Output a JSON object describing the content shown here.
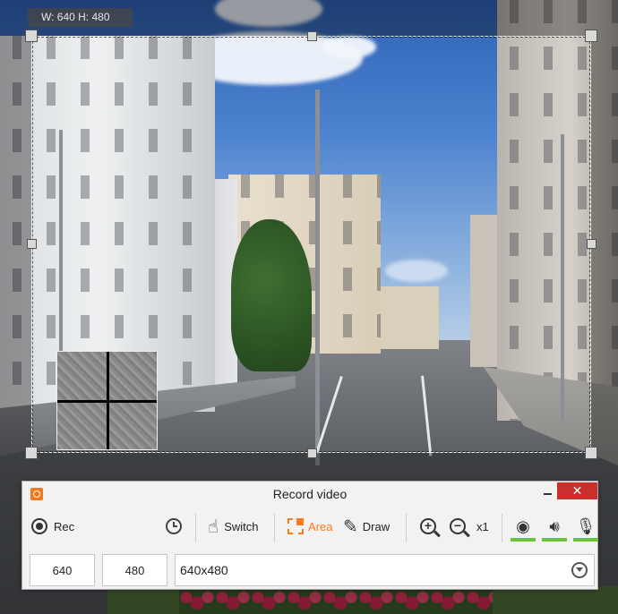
{
  "capture": {
    "size_badge": "W: 640 H: 480"
  },
  "window": {
    "title": "Record video",
    "close_glyph": "✕"
  },
  "toolbar": {
    "rec_label": "Rec",
    "switch_label": "Switch",
    "area_label": "Area",
    "draw_label": "Draw",
    "zoom_level": "x1"
  },
  "size_fields": {
    "width": "640",
    "height": "480",
    "preset": "640x480"
  },
  "icons": {
    "app": "app-logo-icon",
    "rec": "record-icon",
    "timer": "clock-icon",
    "switch": "hand-pointer-icon",
    "area": "area-select-icon",
    "draw": "pencil-icon",
    "zoom_in": "zoom-in-icon",
    "zoom_out": "zoom-out-icon",
    "webcam": "webcam-icon",
    "speaker": "speaker-icon",
    "mic": "microphone-icon",
    "dropdown": "chevron-down-circle-icon"
  },
  "colors": {
    "accent": "#ff7a1a",
    "close": "#c9302c",
    "device_on": "#6ac43a"
  }
}
